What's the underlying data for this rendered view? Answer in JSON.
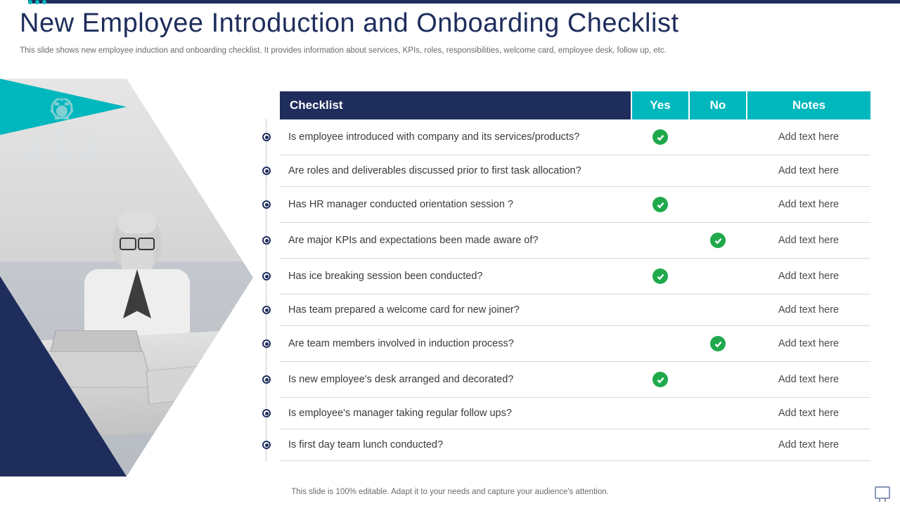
{
  "header": {
    "title": "New Employee Introduction and Onboarding Checklist",
    "subtitle": "This slide shows new employee induction and onboarding checklist. It provides information about services, KPIs, roles, responsibilities, welcome card, employee desk, follow up, etc."
  },
  "table": {
    "headers": {
      "checklist": "Checklist",
      "yes": "Yes",
      "no": "No",
      "notes": "Notes"
    },
    "rows": [
      {
        "q": "Is employee introduced with company and its services/products?",
        "yes": true,
        "no": false,
        "notes": "Add text here"
      },
      {
        "q": "Are roles and deliverables discussed prior to first task allocation?",
        "yes": false,
        "no": false,
        "notes": "Add text here"
      },
      {
        "q": "Has HR manager conducted orientation session ?",
        "yes": true,
        "no": false,
        "notes": "Add text here"
      },
      {
        "q": "Are major KPIs and expectations been made aware of?",
        "yes": false,
        "no": true,
        "notes": "Add text here"
      },
      {
        "q": "Has ice breaking session been conducted?",
        "yes": true,
        "no": false,
        "notes": "Add text here"
      },
      {
        "q": "Has team prepared a welcome card for new joiner?",
        "yes": false,
        "no": false,
        "notes": "Add text here"
      },
      {
        "q": "Are team members involved in induction process?",
        "yes": false,
        "no": true,
        "notes": "Add text here"
      },
      {
        "q": "Is new employee's desk arranged and decorated?",
        "yes": true,
        "no": false,
        "notes": "Add text here"
      },
      {
        "q": "Is employee's manager taking regular follow ups?",
        "yes": false,
        "no": false,
        "notes": "Add text here"
      },
      {
        "q": "Is first day team lunch conducted?",
        "yes": false,
        "no": false,
        "notes": "Add text here"
      }
    ]
  },
  "footer": "This slide is 100% editable. Adapt it to your needs and capture your audience's attention."
}
